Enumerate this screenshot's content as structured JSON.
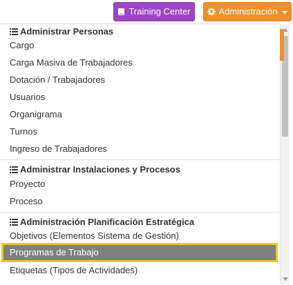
{
  "topbar": {
    "training_label": "Training Center",
    "training_icon": "book-icon",
    "admin_label": "Administración",
    "admin_icon": "gear-icon",
    "colors": {
      "training": "#9c45c5",
      "admin": "#f0902a"
    }
  },
  "menu": {
    "sections": [
      {
        "title": "Administrar Personas",
        "icon": "list-icon",
        "items": [
          "Cargo",
          "Carga Masiva de Trabajadores",
          "Dotación / Trabajadores",
          "Usuarios",
          "Organigrama",
          "Turnos",
          "Ingreso de Trabajadores"
        ]
      },
      {
        "title": "Administrar Instalaciones y Procesos",
        "icon": "list-icon",
        "items": [
          "Proyecto",
          "Proceso"
        ]
      },
      {
        "title": "Administración Planificación Estratégica",
        "icon": "list-icon",
        "items": [
          "Objetivos (Elementos Sistema de Gestión)",
          "Programas de Trabajo",
          "Etiquetas (Tipos de Actividades)"
        ]
      }
    ],
    "selected_item": "Programas de Trabajo",
    "highlight_color": "#f3c623"
  }
}
